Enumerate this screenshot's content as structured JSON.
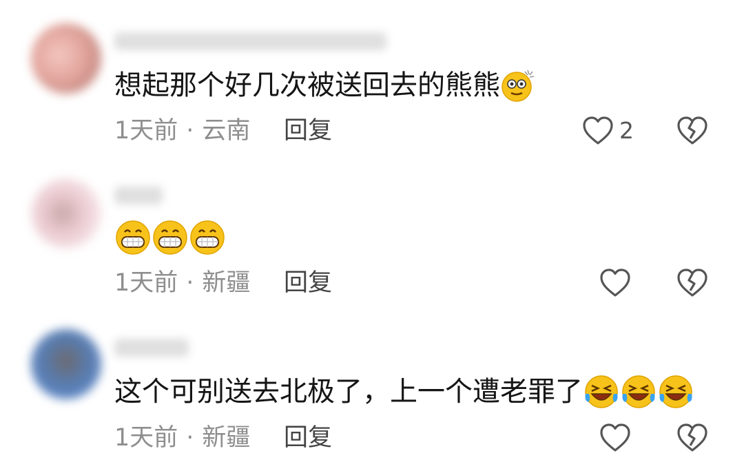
{
  "comments": [
    {
      "text": "想起那个好几次被送回去的熊熊",
      "emojis": [
        "dizzy-face"
      ],
      "time": "1天前",
      "location": "云南",
      "reply_label": "回复",
      "likes": "2"
    },
    {
      "text": "",
      "emojis": [
        "grin-face",
        "grin-face",
        "grin-face"
      ],
      "time": "1天前",
      "location": "新疆",
      "reply_label": "回复",
      "likes": ""
    },
    {
      "text": "这个可别送去北极了，上一个遭老罪了",
      "emojis": [
        "laugh-cry-face",
        "laugh-cry-face",
        "laugh-cry-face"
      ],
      "time": "1天前",
      "location": "新疆",
      "reply_label": "回复",
      "likes": ""
    }
  ],
  "separator": "·",
  "colors": {
    "text": "#151515",
    "meta": "#8e8e8e",
    "icon": "#555555",
    "emoji": "#f7c21a"
  }
}
